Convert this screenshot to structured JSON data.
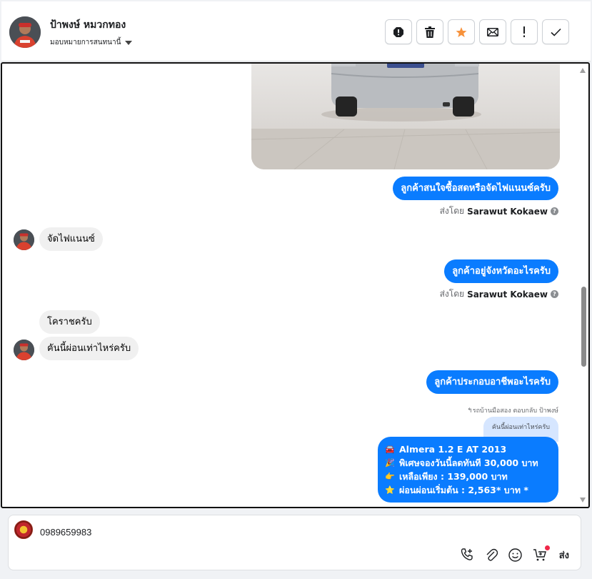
{
  "header": {
    "contact_name": "ป้าพงษ์ หมวกทอง",
    "assign_label": "มอบหมายการสนทนานี้",
    "actions": [
      {
        "name": "spam-button",
        "icon": "alert-octagon-icon"
      },
      {
        "name": "delete-button",
        "icon": "trash-icon"
      },
      {
        "name": "star-button",
        "icon": "star-icon"
      },
      {
        "name": "mark-unread-button",
        "icon": "envelope-icon"
      },
      {
        "name": "important-button",
        "icon": "exclamation-icon"
      },
      {
        "name": "done-button",
        "icon": "check-icon"
      }
    ]
  },
  "thread": {
    "messages": [
      {
        "dir": "out",
        "text": "ลูกค้าสนใจซื้อสดหรือจัดไฟแนนซ์ครับ",
        "sent_by_label": "ส่งโดย",
        "sent_by_name": "Sarawut Kokaew"
      },
      {
        "dir": "in",
        "text": "จัดไฟแนนซ์"
      },
      {
        "dir": "out",
        "text": "ลูกค้าอยู่จังหวัดอะไรครับ",
        "sent_by_label": "ส่งโดย",
        "sent_by_name": "Sarawut Kokaew"
      },
      {
        "dir": "in",
        "text": "โคราชครับ"
      },
      {
        "dir": "in",
        "text": "คันนี้ผ่อนเท่าไหร่ครับ"
      },
      {
        "dir": "out",
        "text": "ลูกค้าประกอบอาชีพอะไรครับ"
      }
    ],
    "reply": {
      "label": "รถบ้านมือสอง ตอบกลับ ป้าพงษ์",
      "quoted": "คันนี้ผ่อนเท่าไหร่ครับ"
    },
    "card": {
      "lines": [
        {
          "icon": "car-icon",
          "text": "Almera 1.2 E AT 2013"
        },
        {
          "icon": "party-icon",
          "text": "พิเศษจองวันนี้ลดทันที 30,000 บาท"
        },
        {
          "icon": "pointing-hand-icon",
          "text": "เหลือเพียง : 139,000 บาท"
        },
        {
          "icon": "star-icon",
          "text": "ผ่อนผ่อนเริ่มต้น : 2,563* บาท *"
        }
      ]
    }
  },
  "composer": {
    "value": "0989659983",
    "send_label": "ส่ง"
  },
  "colors": {
    "accent": "#0a7cff",
    "incoming_bubble": "#f0f0f0",
    "star": "#f7923b",
    "notification": "#f02849"
  }
}
